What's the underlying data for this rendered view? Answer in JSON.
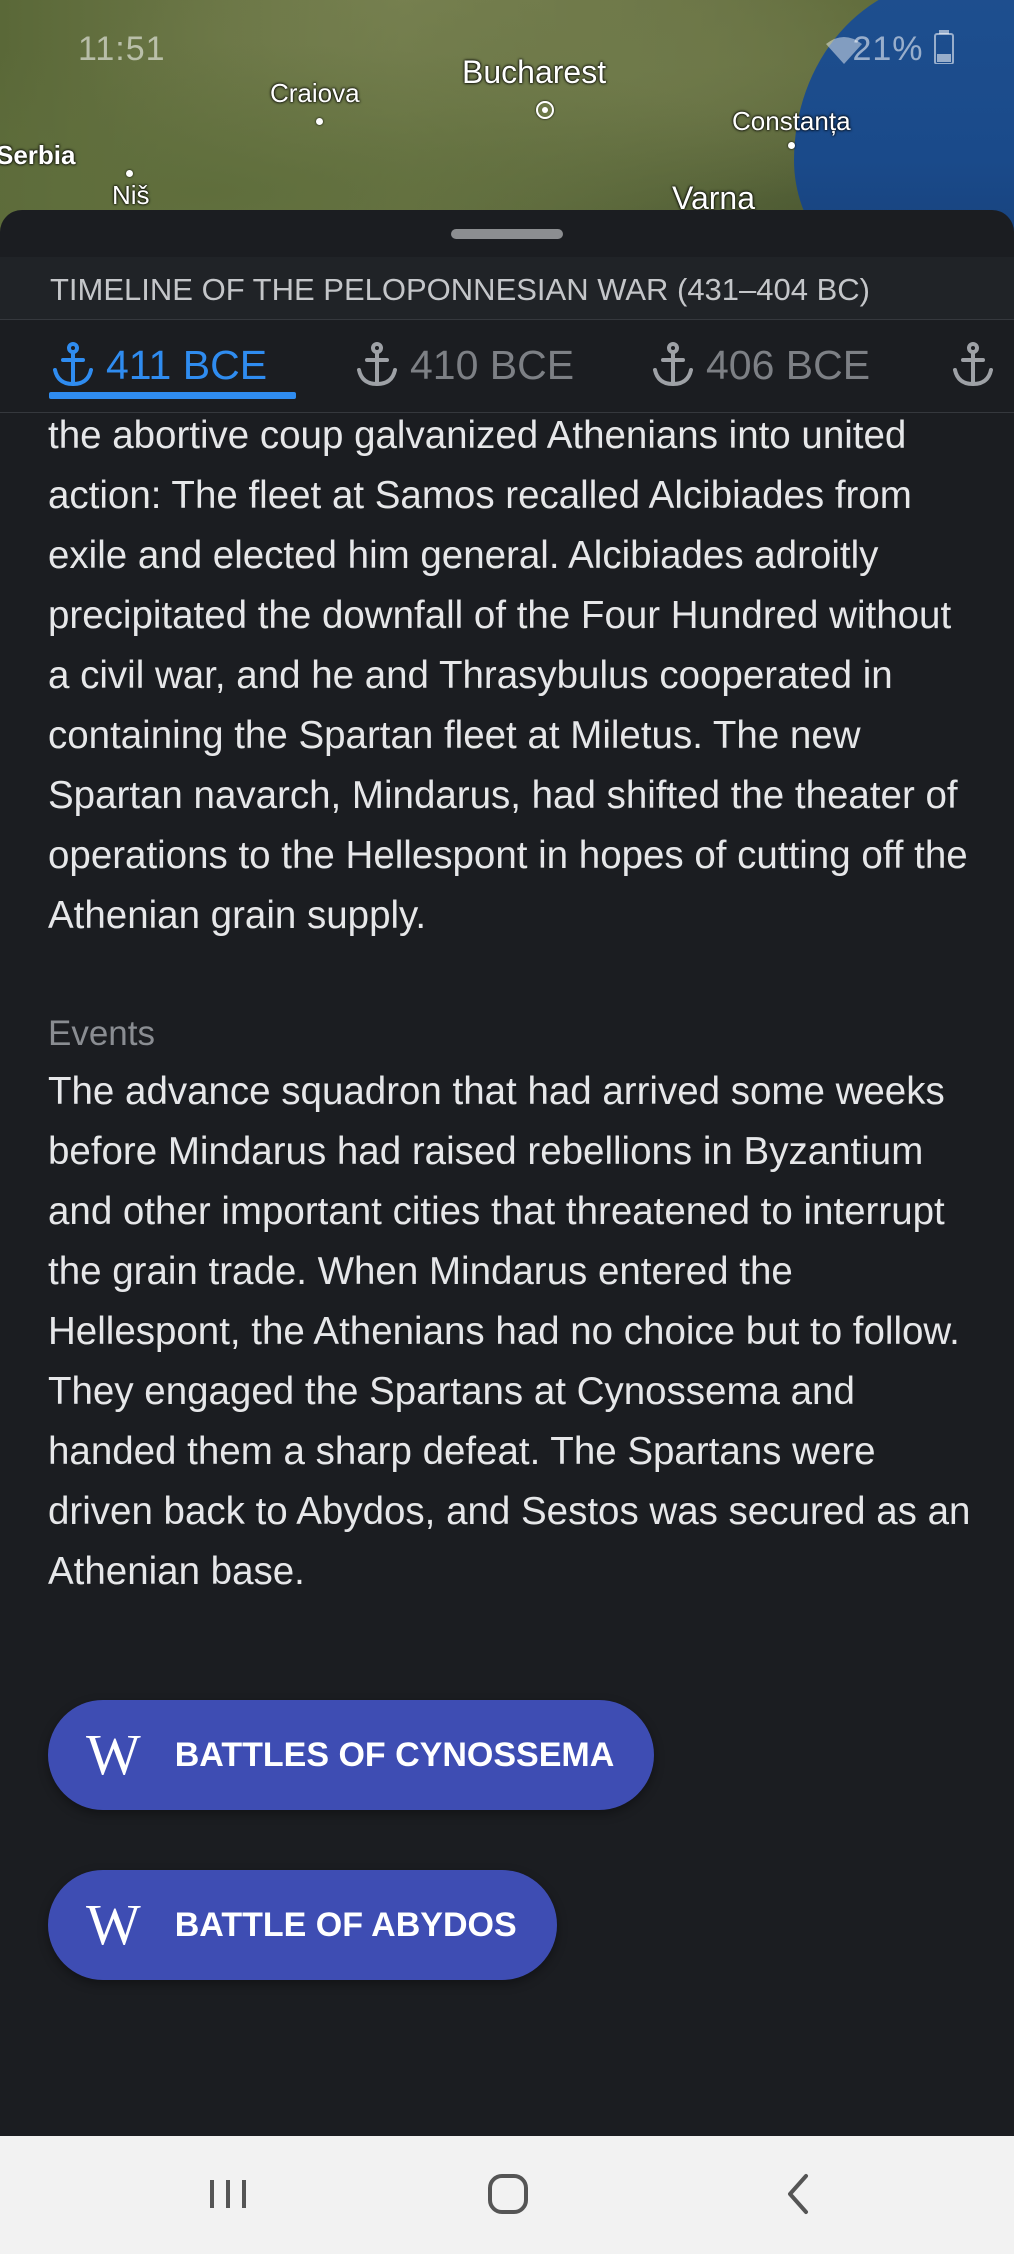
{
  "status_bar": {
    "time": "11:51",
    "battery": "21%"
  },
  "map": {
    "labels": [
      {
        "name": "Craiova"
      },
      {
        "name": "Bucharest"
      },
      {
        "name": "Constanța"
      },
      {
        "name": "Serbia"
      },
      {
        "name": "Niš"
      },
      {
        "name": "Varna"
      }
    ]
  },
  "header": {
    "title": "TIMELINE OF THE PELOPONNESIAN WAR (431–404 BC)"
  },
  "tabs": [
    {
      "label": "411 BCE",
      "active": true
    },
    {
      "label": "410 BCE",
      "active": false
    },
    {
      "label": "406 BCE",
      "active": false
    }
  ],
  "content": {
    "intro": "the abortive coup galvanized Athenians into united action: The fleet at Samos recalled Alcibiades from exile and elected him general. Alcibiades adroitly precipitated the downfall of the Four Hundred without a civil war, and he and Thrasybulus cooperated in containing the Spartan fleet at Miletus. The new Spartan navarch, Mindarus, had shifted the theater of operations to the Hellespont in hopes of cutting off the Athenian grain supply.",
    "events_label": "Events",
    "events_text": "The advance squadron that had arrived some weeks before Mindarus had raised rebellions in Byzantium and other important cities that threatened to interrupt the grain trade. When Mindarus entered the Hellespont, the Athenians had no choice but to follow. They engaged the Spartans at Cynossema and handed them a sharp defeat. The Spartans were driven back to Abydos, and Sestos was secured as an Athenian base."
  },
  "links": [
    {
      "icon": "W",
      "label": "BATTLES OF CYNOSSEMA"
    },
    {
      "icon": "W",
      "label": "BATTLE OF ABYDOS"
    }
  ],
  "colors": {
    "accent": "#2f8cf0",
    "button": "#3e4db3",
    "sheet": "#1b1d21"
  }
}
